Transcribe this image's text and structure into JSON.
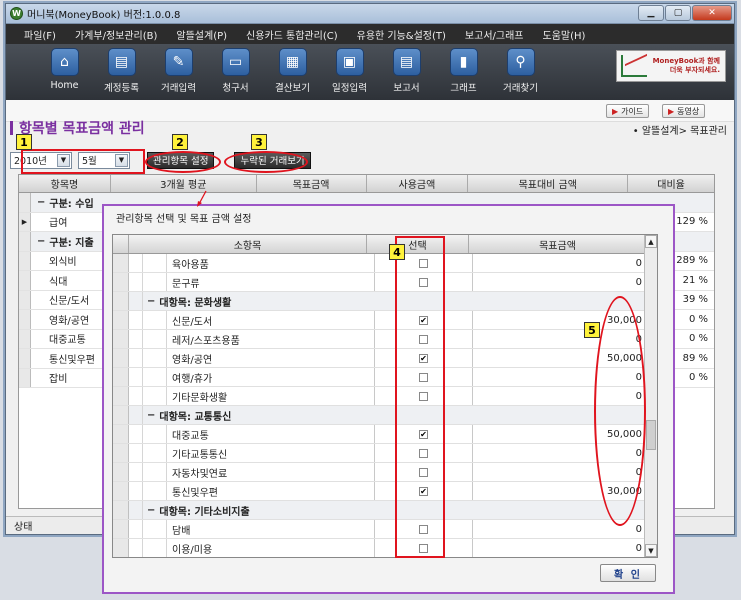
{
  "window": {
    "title": "머니북(MoneyBook) 버전:1.0.0.8",
    "app_icon": "W"
  },
  "menu": [
    "파일(F)",
    "가계부/정보관리(B)",
    "알뜰설계(P)",
    "신용카드 통합관리(C)",
    "유용한 기능&설정(T)",
    "보고서/그래프",
    "도움말(H)"
  ],
  "toolbar": [
    {
      "label": "Home",
      "icon": "home-icon",
      "glyph": "⌂"
    },
    {
      "label": "계정등록",
      "icon": "account-register-icon",
      "glyph": "▤"
    },
    {
      "label": "거래입력",
      "icon": "transaction-input-icon",
      "glyph": "✎"
    },
    {
      "label": "청구서",
      "icon": "bill-icon",
      "glyph": "▭"
    },
    {
      "label": "결산보기",
      "icon": "settlement-icon",
      "glyph": "▦"
    },
    {
      "label": "일정입력",
      "icon": "calendar-icon",
      "glyph": "▣"
    },
    {
      "label": "보고서",
      "icon": "report-icon",
      "glyph": "▤"
    },
    {
      "label": "그래프",
      "icon": "graph-icon",
      "glyph": "▮"
    },
    {
      "label": "거래찾기",
      "icon": "search-icon",
      "glyph": "⚲"
    }
  ],
  "promo": {
    "line1": "MoneyBook과 함께",
    "line2": "더욱 부자되세요."
  },
  "subbar": {
    "guide": "가이드",
    "video": "동영상"
  },
  "page": {
    "title": "항목별 목표금액 관리",
    "breadcrumb": "• 알뜰설계> 목표관리"
  },
  "filters": {
    "year": "2010년",
    "month": "5월",
    "manage_button": "관리항목 설정",
    "missing_button": "누락된 거래보기"
  },
  "markers": {
    "m1": "1",
    "m2": "2",
    "m3": "3",
    "m4": "4",
    "m5": "5"
  },
  "grid": {
    "headers": [
      "항목명",
      "3개월 평균",
      "목표금액",
      "사용금액",
      "목표대비 금액",
      "대비율"
    ],
    "rows": [
      {
        "type": "group",
        "name": "구분: 수입",
        "pct": ""
      },
      {
        "type": "item",
        "name": "급여",
        "pct": "129 %",
        "current": true
      },
      {
        "type": "group",
        "name": "구분: 지출",
        "pct": ""
      },
      {
        "type": "item",
        "name": "외식비",
        "pct": "289 %"
      },
      {
        "type": "item",
        "name": "식대",
        "pct": "21 %"
      },
      {
        "type": "item",
        "name": "신문/도서",
        "pct": "39 %"
      },
      {
        "type": "item",
        "name": "영화/공연",
        "pct": "0 %"
      },
      {
        "type": "item",
        "name": "대중교통",
        "pct": "0 %"
      },
      {
        "type": "item",
        "name": "통신및우편",
        "pct": "89 %"
      },
      {
        "type": "item",
        "name": "잡비",
        "pct": "0 %"
      }
    ]
  },
  "status": "상태",
  "dialog": {
    "title": "관리항목 선택 및 목표 금액 설정",
    "headers": [
      "소항목",
      "선택",
      "목표금액"
    ],
    "ok": "확 인",
    "rows": [
      {
        "type": "item",
        "name": "육아용품",
        "checked": false,
        "amount": "0"
      },
      {
        "type": "item",
        "name": "문구류",
        "checked": false,
        "amount": "0"
      },
      {
        "type": "group",
        "name": "대항목: 문화생활"
      },
      {
        "type": "item",
        "name": "신문/도서",
        "checked": true,
        "amount": "30,000"
      },
      {
        "type": "item",
        "name": "레저/스포츠용품",
        "checked": false,
        "amount": "0"
      },
      {
        "type": "item",
        "name": "영화/공연",
        "checked": true,
        "amount": "50,000"
      },
      {
        "type": "item",
        "name": "여행/휴가",
        "checked": false,
        "amount": "0"
      },
      {
        "type": "item",
        "name": "기타문화생활",
        "checked": false,
        "amount": "0"
      },
      {
        "type": "group",
        "name": "대항목: 교통통신"
      },
      {
        "type": "item",
        "name": "대중교통",
        "checked": true,
        "amount": "50,000"
      },
      {
        "type": "item",
        "name": "기타교통통신",
        "checked": false,
        "amount": "0"
      },
      {
        "type": "item",
        "name": "자동차및연료",
        "checked": false,
        "amount": "0"
      },
      {
        "type": "item",
        "name": "통신및우편",
        "checked": true,
        "amount": "30,000"
      },
      {
        "type": "group",
        "name": "대항목: 기타소비지출"
      },
      {
        "type": "item",
        "name": "담배",
        "checked": false,
        "amount": "0"
      },
      {
        "type": "item",
        "name": "이용/미용",
        "checked": false,
        "amount": "0"
      }
    ]
  }
}
